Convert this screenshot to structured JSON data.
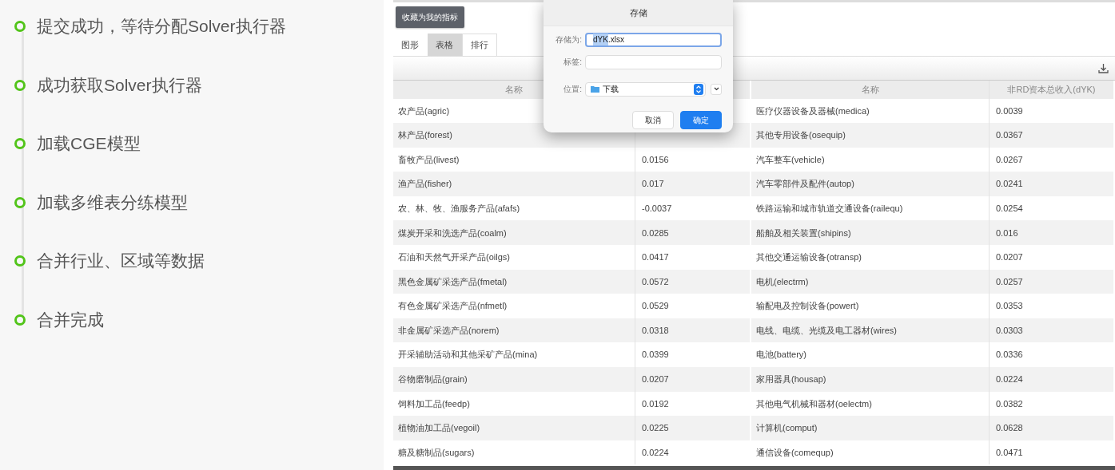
{
  "steps": [
    {
      "text": "提交成功，等待分配Solver执行器"
    },
    {
      "text": "成功获取Solver执行器"
    },
    {
      "text": "加载CGE模型"
    },
    {
      "text": "加载多维表分练模型"
    },
    {
      "text": "合并行业、区域等数据"
    },
    {
      "text": "合并完成"
    }
  ],
  "favorite_button": "收藏为我的指标",
  "tabs": [
    {
      "label": "图形",
      "selected": false
    },
    {
      "label": "表格",
      "selected": true
    },
    {
      "label": "排行",
      "selected": false
    }
  ],
  "left_table": {
    "columns": [
      "名称"
    ],
    "rows": [
      {
        "name": "农产品(agric)"
      },
      {
        "name": "林产品(forest)"
      },
      {
        "name": "畜牧产品(livest)",
        "value": "0.0156"
      },
      {
        "name": "渔产品(fisher)",
        "value": "0.017"
      },
      {
        "name": "农、林、牧、渔服务产品(afafs)",
        "value": "-0.0037"
      },
      {
        "name": "煤炭开采和洗选产品(coalm)",
        "value": "0.0285"
      },
      {
        "name": "石油和天然气开采产品(oilgs)",
        "value": "0.0417"
      },
      {
        "name": "黑色金属矿采选产品(fmetal)",
        "value": "0.0572"
      },
      {
        "name": "有色金属矿采选产品(nfmetl)",
        "value": "0.0529"
      },
      {
        "name": "非金属矿采选产品(norem)",
        "value": "0.0318"
      },
      {
        "name": "开采辅助活动和其他采矿产品(mina)",
        "value": "0.0399"
      },
      {
        "name": "谷物磨制品(grain)",
        "value": "0.0207"
      },
      {
        "name": "饲料加工品(feedp)",
        "value": "0.0192"
      },
      {
        "name": "植物油加工品(vegoil)",
        "value": "0.0225"
      },
      {
        "name": "糖及糖制品(sugars)",
        "value": "0.0224"
      }
    ]
  },
  "right_table": {
    "columns": [
      "名称",
      "非RD资本总收入(dYK)"
    ],
    "rows": [
      {
        "name": "医疗仪器设备及器械(medica)",
        "value": "0.0039"
      },
      {
        "name": "其他专用设备(osequip)",
        "value": "0.0367"
      },
      {
        "name": "汽车整车(vehicle)",
        "value": "0.0267"
      },
      {
        "name": "汽车零部件及配件(autop)",
        "value": "0.0241"
      },
      {
        "name": "铁路运输和城市轨道交通设备(railequ)",
        "value": "0.0254"
      },
      {
        "name": "船舶及相关装置(shipins)",
        "value": "0.016"
      },
      {
        "name": "其他交通运输设备(otransp)",
        "value": "0.0207"
      },
      {
        "name": "电机(electrm)",
        "value": "0.0257"
      },
      {
        "name": "输配电及控制设备(powert)",
        "value": "0.0353"
      },
      {
        "name": "电线、电缆、光缆及电工器材(wires)",
        "value": "0.0303"
      },
      {
        "name": "电池(battery)",
        "value": "0.0336"
      },
      {
        "name": "家用器具(housap)",
        "value": "0.0224"
      },
      {
        "name": "其他电气机械和器材(oelectm)",
        "value": "0.0382"
      },
      {
        "name": "计算机(comput)",
        "value": "0.0628"
      },
      {
        "name": "通信设备(comequp)",
        "value": "0.0471"
      }
    ]
  },
  "dialog": {
    "title": "存储",
    "save_as_label": "存储为:",
    "save_as_selected": "dYK",
    "save_as_rest": ".xlsx",
    "tags_label": "标签:",
    "location_label": "位置:",
    "location": "下载",
    "buttons": [
      {
        "label": "取消",
        "kind": "secondary"
      },
      {
        "label": "确定",
        "kind": "primary"
      }
    ]
  }
}
